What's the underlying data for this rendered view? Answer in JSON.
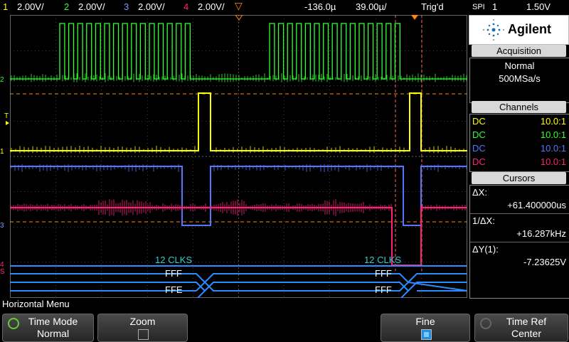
{
  "topbar": {
    "ch1_num": "1",
    "ch1_scale": "2.00V/",
    "ch2_num": "2",
    "ch2_scale": "2.00V/",
    "ch3_num": "3",
    "ch3_scale": "2.00V/",
    "ch4_num": "4",
    "ch4_scale": "2.00V/",
    "time_delay": "-136.0µ",
    "time_scale": "39.00µ/",
    "trigger_status": "Trig'd",
    "trigger_source_type": "SPI",
    "trigger_source": "1",
    "trigger_level": "1.50V"
  },
  "screen": {
    "bus_labels": {
      "clk_left": "12 CLKS",
      "clk_right": "12 CLKS",
      "mosi_left": "FFF",
      "mosi_right": "FFF",
      "miso_left": "FFE",
      "miso_right": "FFF"
    },
    "markers": {
      "ch2": "2",
      "ch1": "1",
      "ch3": "3",
      "ch4": "4",
      "trig": "T",
      "spi": "S"
    }
  },
  "panel": {
    "brand": "Agilent",
    "acquisition": {
      "title": "Acquisition",
      "mode": "Normal",
      "rate": "500MSa/s"
    },
    "channels": {
      "title": "Channels",
      "rows": [
        {
          "coupling": "DC",
          "probe": "10.0:1",
          "color": "#ffff00"
        },
        {
          "coupling": "DC",
          "probe": "10.0:1",
          "color": "#33ff33"
        },
        {
          "coupling": "DC",
          "probe": "10.0:1",
          "color": "#5577ff"
        },
        {
          "coupling": "DC",
          "probe": "10.0:1",
          "color": "#ff2277"
        }
      ]
    },
    "cursors": {
      "title": "Cursors",
      "dx_label": "ΔX:",
      "dx_value": "+61.400000us",
      "inv_dx_label": "1/ΔX:",
      "inv_dx_value": "+16.287kHz",
      "dy_label": "ΔY(1):",
      "dy_value": "-7.23625V"
    }
  },
  "menu": {
    "title": "Horizontal Menu",
    "softkeys": [
      {
        "line1": "Time Mode",
        "line2": "Normal"
      },
      {
        "line1": "Zoom",
        "line2": ""
      },
      {
        "line1": "Fine",
        "line2": ""
      },
      {
        "line1": "Time Ref",
        "line2": "Center"
      }
    ]
  },
  "colors": {
    "ch1": "#ffff00",
    "ch2": "#33ff33",
    "ch3": "#5577ff",
    "ch4": "#ff2277",
    "bus": "#2a8cff",
    "bus_text": "#33cccc",
    "cursor": "#ff6666",
    "grid": "#555555",
    "accent": "#ff8800"
  }
}
